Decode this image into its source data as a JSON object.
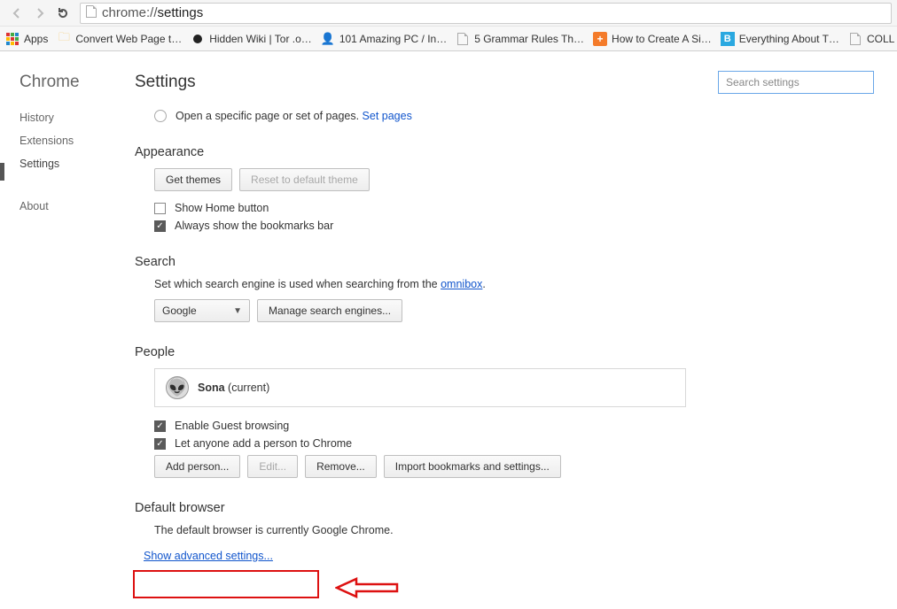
{
  "browser": {
    "url_scheme": "chrome://",
    "url_path": "settings",
    "bookmarks": [
      {
        "label": "Apps",
        "icon": "apps"
      },
      {
        "label": "Convert Web Page t…",
        "icon": "folder"
      },
      {
        "label": "Hidden Wiki | Tor .o…",
        "icon": "dot"
      },
      {
        "label": "101 Amazing PC / In…",
        "icon": "face"
      },
      {
        "label": "5 Grammar Rules Th…",
        "icon": "page"
      },
      {
        "label": "How to Create A Si…",
        "icon": "plus"
      },
      {
        "label": "Everything About T…",
        "icon": "b"
      },
      {
        "label": "COLL",
        "icon": "page"
      }
    ]
  },
  "sidebar": {
    "brand": "Chrome",
    "items": [
      "History",
      "Extensions",
      "Settings"
    ],
    "about": "About",
    "active": "Settings"
  },
  "header": {
    "title": "Settings",
    "search_placeholder": "Search settings"
  },
  "startup": {
    "radio_label": "Open a specific page or set of pages. ",
    "link": "Set pages"
  },
  "appearance": {
    "title": "Appearance",
    "get_themes": "Get themes",
    "reset_theme": "Reset to default theme",
    "show_home": "Show Home button",
    "show_bm": "Always show the bookmarks bar"
  },
  "search": {
    "title": "Search",
    "helper_pre": "Set which search engine is used when searching from the ",
    "helper_link": "omnibox",
    "helper_post": ".",
    "engine": "Google",
    "manage": "Manage search engines..."
  },
  "people": {
    "title": "People",
    "name": "Sona",
    "suffix": " (current)",
    "guest": "Enable Guest browsing",
    "anyone": "Let anyone add a person to Chrome",
    "add": "Add person...",
    "edit": "Edit...",
    "remove": "Remove...",
    "import": "Import bookmarks and settings..."
  },
  "default_browser": {
    "title": "Default browser",
    "text": "The default browser is currently Google Chrome."
  },
  "advanced_link": "Show advanced settings..."
}
